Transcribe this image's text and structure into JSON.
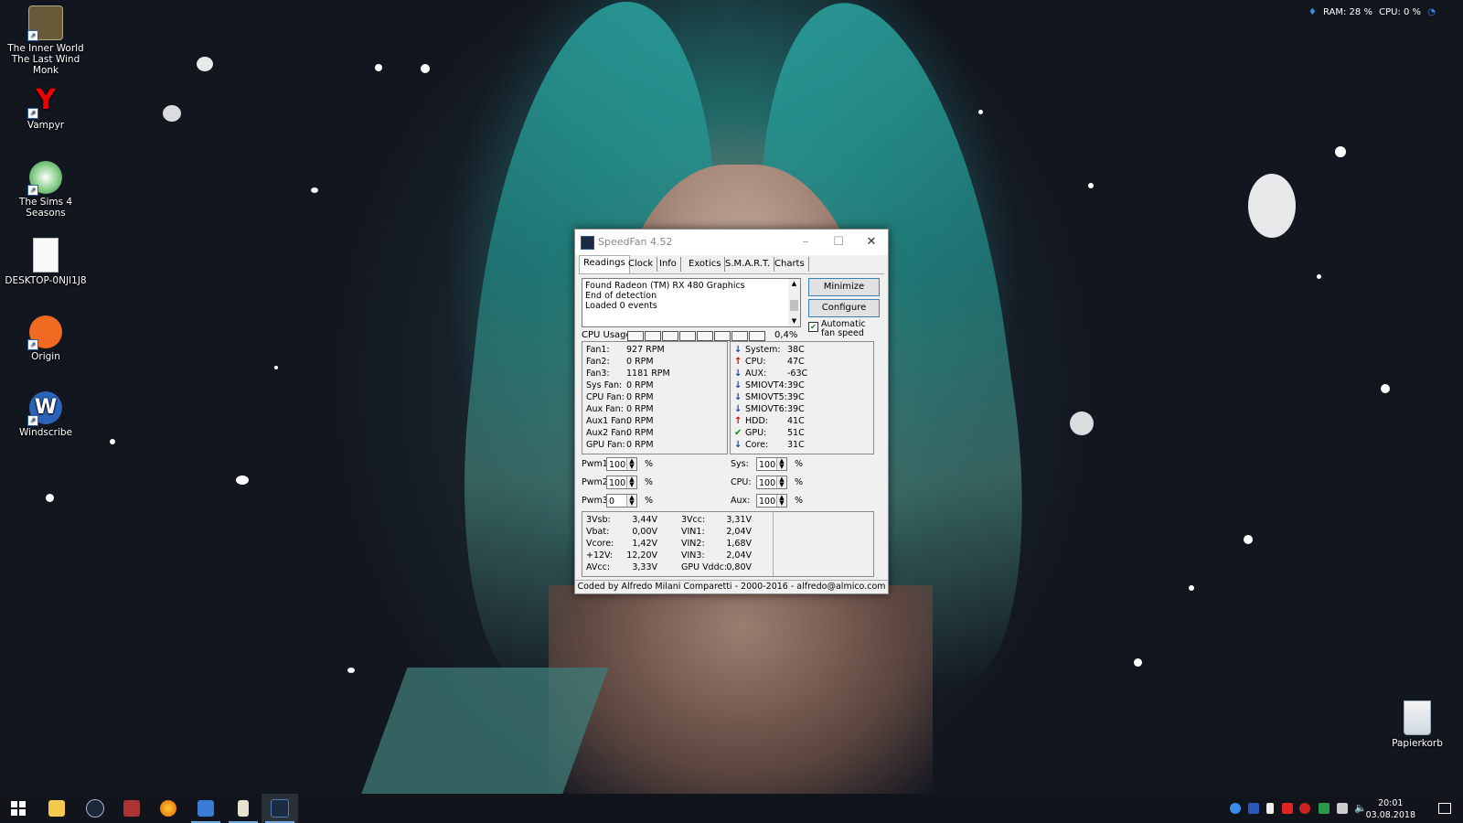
{
  "desktop": {
    "icons": [
      {
        "label": "The Inner World The Last Wind Monk",
        "icon": "game-icon"
      },
      {
        "label": "Vampyr",
        "icon": "yandex-icon"
      },
      {
        "label": "The Sims 4 Seasons",
        "icon": "sims-plumbob-icon"
      },
      {
        "label": "DESKTOP-0NJI1J8",
        "icon": "text-file-icon"
      },
      {
        "label": "Origin",
        "icon": "origin-icon"
      },
      {
        "label": "Windscribe",
        "icon": "windscribe-icon"
      }
    ],
    "recycle_bin": {
      "label": "Papierkorb",
      "icon": "recycle-bin-icon"
    },
    "overlay": {
      "ram": "RAM: 28 %",
      "cpu": "CPU: 0 %"
    }
  },
  "window": {
    "title": "SpeedFan 4.52",
    "tabs": [
      "Readings",
      "Clock",
      "Info",
      "Exotics",
      "S.M.A.R.T.",
      "Charts"
    ],
    "selected_tab": "Readings",
    "log": [
      "Found Radeon (TM) RX 480 Graphics",
      "End of detection",
      "Loaded 0 events"
    ],
    "buttons": {
      "minimize": "Minimize",
      "configure": "Configure"
    },
    "auto_fan": {
      "label": "Automatic fan speed",
      "checked": true
    },
    "cpu_usage": {
      "label": "CPU Usage",
      "value": "0,4%",
      "cores": 8
    },
    "fans": [
      {
        "name": "Fan1:",
        "value": "927 RPM"
      },
      {
        "name": "Fan2:",
        "value": "0 RPM"
      },
      {
        "name": "Fan3:",
        "value": "1181 RPM"
      },
      {
        "name": "Sys Fan:",
        "value": "0 RPM"
      },
      {
        "name": "CPU Fan:",
        "value": "0 RPM"
      },
      {
        "name": "Aux Fan:",
        "value": "0 RPM"
      },
      {
        "name": "Aux1 Fan:",
        "value": "0 RPM"
      },
      {
        "name": "Aux2 Fan:",
        "value": "0 RPM"
      },
      {
        "name": "GPU Fan:",
        "value": "0 RPM"
      }
    ],
    "temps": [
      {
        "name": "System:",
        "value": "38C",
        "trend": "down"
      },
      {
        "name": "CPU:",
        "value": "47C",
        "trend": "up"
      },
      {
        "name": "AUX:",
        "value": "-63C",
        "trend": "down"
      },
      {
        "name": "SMIOVT4:",
        "value": "39C",
        "trend": "down"
      },
      {
        "name": "SMIOVT5:",
        "value": "39C",
        "trend": "down"
      },
      {
        "name": "SMIOVT6:",
        "value": "39C",
        "trend": "down"
      },
      {
        "name": "HDD:",
        "value": "41C",
        "trend": "up"
      },
      {
        "name": "GPU:",
        "value": "51C",
        "trend": "ok"
      },
      {
        "name": "Core:",
        "value": "31C",
        "trend": "down"
      }
    ],
    "pwm_left": [
      {
        "label": "Pwm1:",
        "value": "100",
        "unit": "%"
      },
      {
        "label": "Pwm2:",
        "value": "100",
        "unit": "%"
      },
      {
        "label": "Pwm3:",
        "value": "0",
        "unit": "%"
      }
    ],
    "pwm_right": [
      {
        "label": "Sys:",
        "value": "100",
        "unit": "%"
      },
      {
        "label": "CPU:",
        "value": "100",
        "unit": "%"
      },
      {
        "label": "Aux:",
        "value": "100",
        "unit": "%"
      }
    ],
    "voltages_left": [
      {
        "name": "3Vsb:",
        "value": "3,44V"
      },
      {
        "name": "Vbat:",
        "value": "0,00V"
      },
      {
        "name": "Vcore:",
        "value": "1,42V"
      },
      {
        "name": "+12V:",
        "value": "12,20V"
      },
      {
        "name": "AVcc:",
        "value": "3,33V"
      }
    ],
    "voltages_right": [
      {
        "name": "3Vcc:",
        "value": "3,31V"
      },
      {
        "name": "VIN1:",
        "value": "2,04V"
      },
      {
        "name": "VIN2:",
        "value": "1,68V"
      },
      {
        "name": "VIN3:",
        "value": "2,04V"
      },
      {
        "name": "GPU Vddc:",
        "value": "0,80V"
      }
    ],
    "footer": "Coded by Alfredo Milani Comparetti - 2000-2016 - alfredo@almico.com"
  },
  "taskbar": {
    "time": "20:01",
    "date": "03.08.2018"
  },
  "colors": {
    "up": "#d40000",
    "down": "#1a3fb0",
    "ok": "#1a8a1a",
    "accent": "#3c7fb1"
  }
}
